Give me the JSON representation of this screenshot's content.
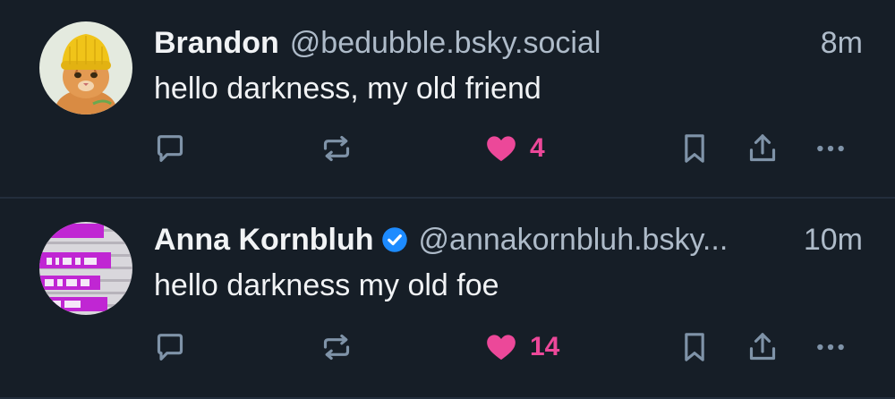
{
  "posts": [
    {
      "author_name": "Brandon",
      "handle": "@bedubble.bsky.social",
      "time": "8m",
      "text": "hello darkness, my old friend",
      "verified": false,
      "avatar": "cat-with-yellow-beanie",
      "like_count": "4",
      "liked": true
    },
    {
      "author_name": "Anna Kornbluh",
      "handle": "@annakornbluh.bsky...",
      "time": "10m",
      "text": "hello darkness my old foe",
      "verified": true,
      "avatar": "book-cover-purple-text",
      "like_count": "14",
      "liked": true
    }
  ],
  "icons": {
    "reply": "reply-icon",
    "repost": "repost-icon",
    "like": "heart-icon",
    "bookmark": "bookmark-icon",
    "share": "share-icon",
    "more": "more-icon",
    "verified": "verified-check-icon"
  },
  "colors": {
    "background": "#161e27",
    "divider": "#232e3c",
    "text": "#f1f3f5",
    "muted": "#aebbc9",
    "icon": "#7f93a8",
    "like": "#ec4899",
    "verified": "#1d8bff"
  }
}
